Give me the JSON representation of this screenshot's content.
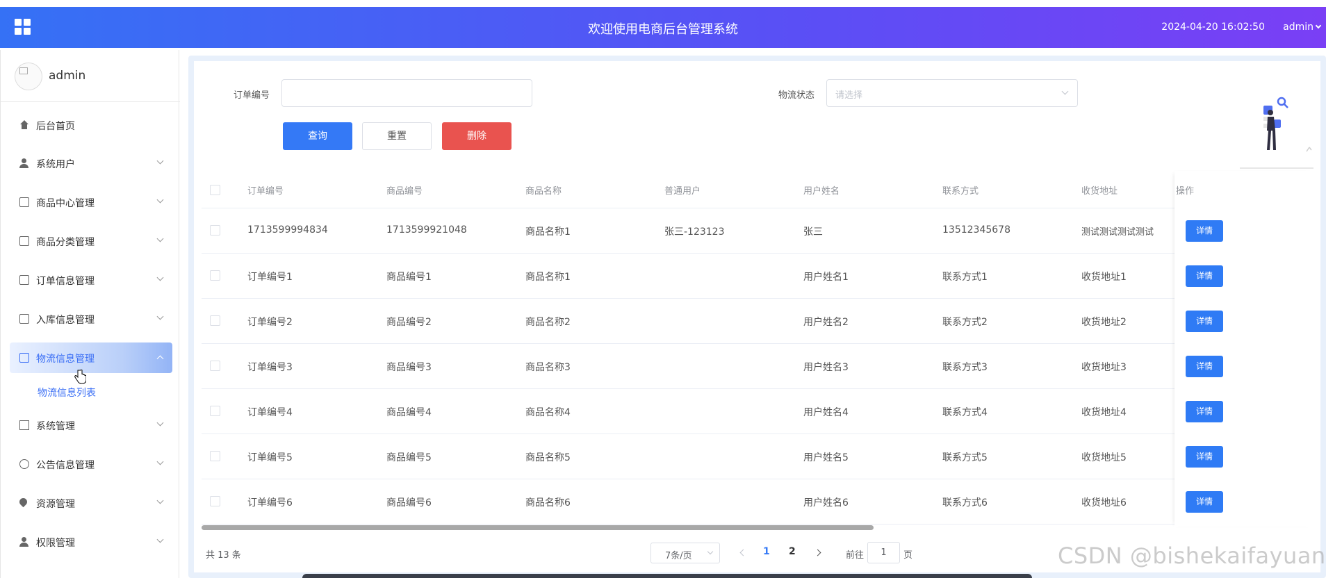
{
  "header": {
    "title": "欢迎使用电商后台管理系统",
    "datetime": "2024-04-20 16:02:50",
    "user": "admin"
  },
  "sidebar": {
    "username": "admin",
    "items": [
      {
        "label": "后台首页",
        "icon": "home-icon"
      },
      {
        "label": "系统用户",
        "icon": "user-icon"
      },
      {
        "label": "商品中心管理",
        "icon": "box-icon"
      },
      {
        "label": "商品分类管理",
        "icon": "box-icon"
      },
      {
        "label": "订单信息管理",
        "icon": "box-icon"
      },
      {
        "label": "入库信息管理",
        "icon": "box-icon"
      },
      {
        "label": "物流信息管理",
        "icon": "box-icon"
      },
      {
        "label": "系统管理",
        "icon": "image-icon"
      },
      {
        "label": "公告信息管理",
        "icon": "info-icon"
      },
      {
        "label": "资源管理",
        "icon": "pin-icon"
      },
      {
        "label": "权限管理",
        "icon": "user-icon"
      }
    ],
    "active_sub": "物流信息列表"
  },
  "search": {
    "order_label": "订单编号",
    "order_value": "",
    "status_label": "物流状态",
    "status_placeholder": "请选择",
    "query_btn": "查询",
    "reset_btn": "重置",
    "delete_btn": "删除"
  },
  "table": {
    "headers": [
      "订单编号",
      "商品编号",
      "商品名称",
      "普通用户",
      "用户姓名",
      "联系方式",
      "收货地址",
      "操作"
    ],
    "detail_label": "详情",
    "rows": [
      [
        "1713599994834",
        "1713599921048",
        "商品名称1",
        "张三-123123",
        "张三",
        "13512345678",
        "测试测试测试测试"
      ],
      [
        "订单编号1",
        "商品编号1",
        "商品名称1",
        "",
        "用户姓名1",
        "联系方式1",
        "收货地址1"
      ],
      [
        "订单编号2",
        "商品编号2",
        "商品名称2",
        "",
        "用户姓名2",
        "联系方式2",
        "收货地址2"
      ],
      [
        "订单编号3",
        "商品编号3",
        "商品名称3",
        "",
        "用户姓名3",
        "联系方式3",
        "收货地址3"
      ],
      [
        "订单编号4",
        "商品编号4",
        "商品名称4",
        "",
        "用户姓名4",
        "联系方式4",
        "收货地址4"
      ],
      [
        "订单编号5",
        "商品编号5",
        "商品名称5",
        "",
        "用户姓名5",
        "联系方式5",
        "收货地址5"
      ],
      [
        "订单编号6",
        "商品编号6",
        "商品名称6",
        "",
        "用户姓名6",
        "联系方式6",
        "收货地址6"
      ]
    ]
  },
  "pagination": {
    "total": "共 13 条",
    "page_size": "7条/页",
    "pages": [
      "1",
      "2"
    ],
    "current": "1",
    "goto_prefix": "前往",
    "goto_value": "1",
    "goto_suffix": "页"
  },
  "watermark": "CSDN @bishekaifayuan",
  "colors": {
    "primary": "#3479f6",
    "danger": "#e9534f",
    "header_start": "#3571f5",
    "header_end": "#7a3ff5"
  }
}
